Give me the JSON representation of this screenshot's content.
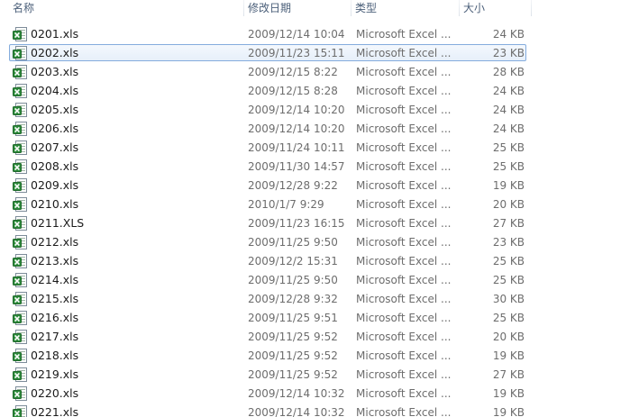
{
  "columns": {
    "name": "名称",
    "date": "修改日期",
    "type": "类型",
    "size": "大小"
  },
  "files": [
    {
      "name": "0201.xls",
      "date": "2009/12/14 10:04",
      "type": "Microsoft Excel ...",
      "size": "24 KB"
    },
    {
      "name": "0202.xls",
      "date": "2009/11/23 15:11",
      "type": "Microsoft Excel ...",
      "size": "23 KB",
      "selected": true
    },
    {
      "name": "0203.xls",
      "date": "2009/12/15 8:22",
      "type": "Microsoft Excel ...",
      "size": "28 KB"
    },
    {
      "name": "0204.xls",
      "date": "2009/12/15 8:28",
      "type": "Microsoft Excel ...",
      "size": "24 KB"
    },
    {
      "name": "0205.xls",
      "date": "2009/12/14 10:20",
      "type": "Microsoft Excel ...",
      "size": "24 KB"
    },
    {
      "name": "0206.xls",
      "date": "2009/12/14 10:20",
      "type": "Microsoft Excel ...",
      "size": "24 KB"
    },
    {
      "name": "0207.xls",
      "date": "2009/11/24 10:11",
      "type": "Microsoft Excel ...",
      "size": "25 KB"
    },
    {
      "name": "0208.xls",
      "date": "2009/11/30 14:57",
      "type": "Microsoft Excel ...",
      "size": "25 KB"
    },
    {
      "name": "0209.xls",
      "date": "2009/12/28 9:22",
      "type": "Microsoft Excel ...",
      "size": "19 KB"
    },
    {
      "name": "0210.xls",
      "date": "2010/1/7 9:29",
      "type": "Microsoft Excel ...",
      "size": "20 KB"
    },
    {
      "name": "0211.XLS",
      "date": "2009/11/23 16:15",
      "type": "Microsoft Excel ...",
      "size": "27 KB"
    },
    {
      "name": "0212.xls",
      "date": "2009/11/25 9:50",
      "type": "Microsoft Excel ...",
      "size": "23 KB"
    },
    {
      "name": "0213.xls",
      "date": "2009/12/2 15:31",
      "type": "Microsoft Excel ...",
      "size": "25 KB"
    },
    {
      "name": "0214.xls",
      "date": "2009/11/25 9:50",
      "type": "Microsoft Excel ...",
      "size": "25 KB"
    },
    {
      "name": "0215.xls",
      "date": "2009/12/28 9:32",
      "type": "Microsoft Excel ...",
      "size": "30 KB"
    },
    {
      "name": "0216.xls",
      "date": "2009/11/25 9:51",
      "type": "Microsoft Excel ...",
      "size": "25 KB"
    },
    {
      "name": "0217.xls",
      "date": "2009/11/25 9:52",
      "type": "Microsoft Excel ...",
      "size": "20 KB"
    },
    {
      "name": "0218.xls",
      "date": "2009/11/25 9:52",
      "type": "Microsoft Excel ...",
      "size": "19 KB"
    },
    {
      "name": "0219.xls",
      "date": "2009/11/25 9:52",
      "type": "Microsoft Excel ...",
      "size": "27 KB"
    },
    {
      "name": "0220.xls",
      "date": "2009/12/14 10:32",
      "type": "Microsoft Excel ...",
      "size": "19 KB"
    },
    {
      "name": "0221.xls",
      "date": "2009/12/14 10:32",
      "type": "Microsoft Excel ...",
      "size": "19 KB"
    }
  ],
  "icon": "excel-file-icon"
}
